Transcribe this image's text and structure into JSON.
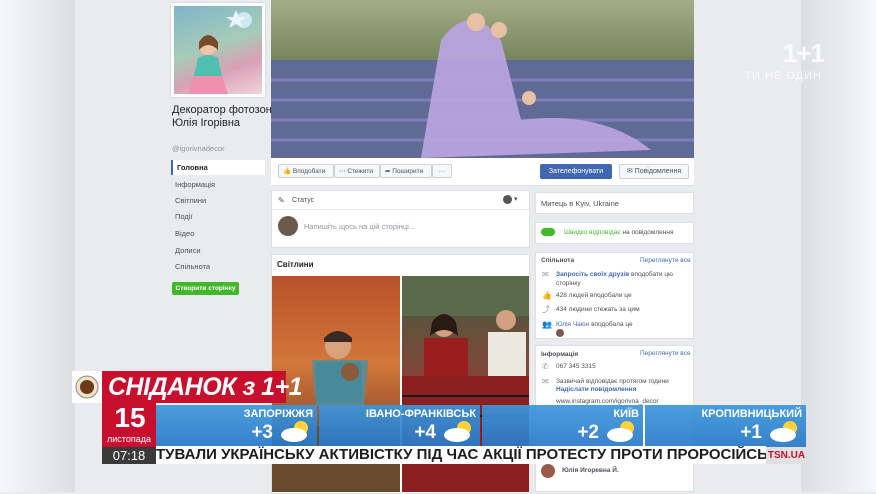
{
  "page": {
    "name": "Декоратор фотозон Юлія Ігорівна",
    "handle": "@igorivnadecor",
    "create_page_button": "Створити сторінку"
  },
  "nav": {
    "items": [
      {
        "label": "Головна",
        "active": true
      },
      {
        "label": "Інформація"
      },
      {
        "label": "Світлини"
      },
      {
        "label": "Події"
      },
      {
        "label": "Відео"
      },
      {
        "label": "Дописи"
      },
      {
        "label": "Спільнота"
      }
    ]
  },
  "actions": {
    "like": "Вподобати",
    "follow": "Стежити",
    "share": "Поширити",
    "more": "···",
    "call": "Зателефонувати",
    "message": "Повідомлення"
  },
  "composer": {
    "status_label": "Статус",
    "placeholder": "Напишіть щось на цій сторінці..."
  },
  "photos": {
    "title": "Світлини"
  },
  "sidebar": {
    "category_location": "Митець в Kyiv, Ukraine",
    "response_fast": "Швидко відповідає",
    "response_suffix": "на повідомлення",
    "community": {
      "title": "Спільнота",
      "see_all": "Переглянути все",
      "invite_link": "Запросіть своїх друзів",
      "invite_suffix": "вподобати цю",
      "invite_line2": "сторінку",
      "likes": "428 людей вподобали це",
      "follows": "434 людини стежать за цим",
      "friend_name": "Юлія Чаюн",
      "friend_suffix": "вподобала це"
    },
    "info": {
      "title": "Інформація",
      "see_all": "Переглянути все",
      "phone": "067 345 3315",
      "reply_note": "Зазвичай відповідає протягом години",
      "send_message": "Надіслати повідомлення",
      "website": "www.instagram.com/igorivna_decor",
      "person_name": "Юлія Игоревна Й."
    }
  },
  "tv": {
    "channel_logo": "1+1",
    "channel_tagline": "ТИ НЕ ОДИН",
    "show_title": "СНІДАНОК з 1+1",
    "date_day": "15",
    "date_month": "листопада",
    "time": "07:18",
    "ticker": "ТУВАЛИ УКРАЇНСЬКУ АКТИВІСТКУ ПІД ЧАС АКЦІЇ ПРОТЕСТУ ПРОТИ ПРОРОСІЙСЬКОГО КО",
    "news_site": "TSN.UA",
    "weather": [
      {
        "city": "ЗАПОРІЖЖЯ",
        "temp": "+3"
      },
      {
        "city": "ІВАНО-ФРАНКІВСЬК",
        "temp": "+4"
      },
      {
        "city": "КИЇВ",
        "temp": "+2"
      },
      {
        "city": "КРОПИВНИЦЬКИЙ",
        "temp": "+1"
      }
    ]
  },
  "colors": {
    "fb_blue": "#4267b2",
    "fb_green": "#42b72a",
    "tv_red": "#c8102e",
    "weather_blue": "#2f8ad6"
  }
}
